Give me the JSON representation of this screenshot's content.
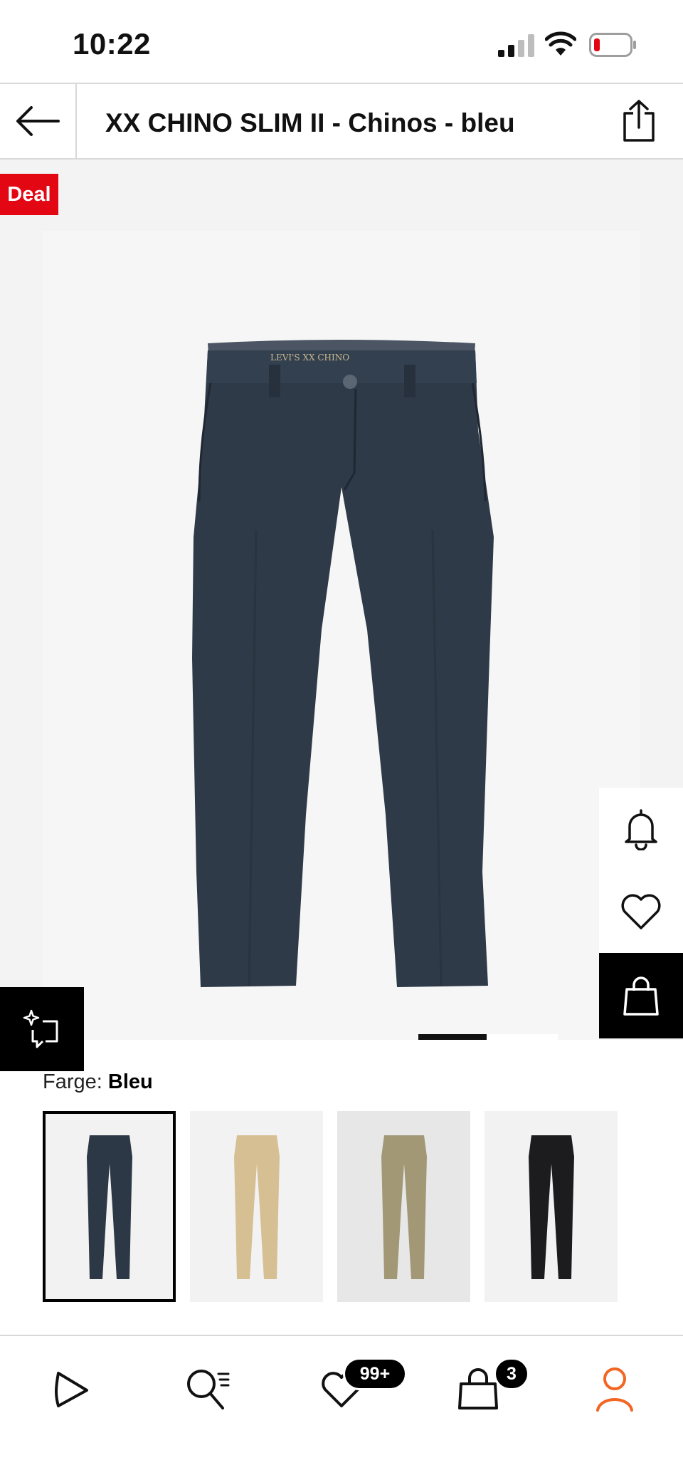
{
  "status_bar": {
    "time": "10:22"
  },
  "header": {
    "title": "XX CHINO SLIM II - Chinos - bleu"
  },
  "product": {
    "deal_badge": "Deal",
    "brand_mark": "LEVI'S XX CHINO"
  },
  "color_selector": {
    "label": "Farge:",
    "selected_value": "Bleu",
    "swatches": [
      {
        "color": "#2c3846",
        "selected": true
      },
      {
        "color": "#d6bf93",
        "selected": false
      },
      {
        "color": "#a29876",
        "selected": false
      },
      {
        "color": "#1c1b1d",
        "selected": false
      }
    ]
  },
  "bottom_nav": {
    "wishlist_badge": "99+",
    "cart_badge": "3"
  },
  "colors": {
    "accent": "#e30613",
    "profile_active": "#f26522",
    "pants": "#2f3a48"
  }
}
